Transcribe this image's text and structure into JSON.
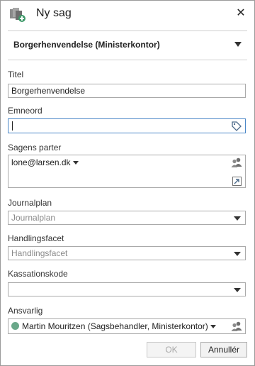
{
  "window": {
    "title": "Ny sag",
    "close_glyph": "✕",
    "app_icon": "case-folder-add-icon"
  },
  "category": {
    "label": "Borgerhenvendelse (Ministerkontor)"
  },
  "form": {
    "titel": {
      "label": "Titel",
      "value": "Borgerhenvendelse"
    },
    "emneord": {
      "label": "Emneord",
      "value": "",
      "icon": "tag-icon"
    },
    "parter": {
      "label": "Sagens parter",
      "value": "lone@larsen.dk",
      "icons": [
        "contacts-icon",
        "open-link-icon"
      ]
    },
    "journalplan": {
      "label": "Journalplan",
      "placeholder": "Journalplan"
    },
    "handlingsfacet": {
      "label": "Handlingsfacet",
      "placeholder": "Handlingsfacet"
    },
    "kassationskode": {
      "label": "Kassationskode",
      "value": ""
    },
    "ansvarlig": {
      "label": "Ansvarlig",
      "value": "Martin Mouritzen (Sagsbehandler, Ministerkontor)",
      "status_color": "#6aa88a",
      "icon": "contacts-icon"
    }
  },
  "buttons": {
    "ok": "OK",
    "cancel": "Annullér"
  },
  "colors": {
    "focus_border": "#4b87c7",
    "icon_gray": "#707070"
  }
}
